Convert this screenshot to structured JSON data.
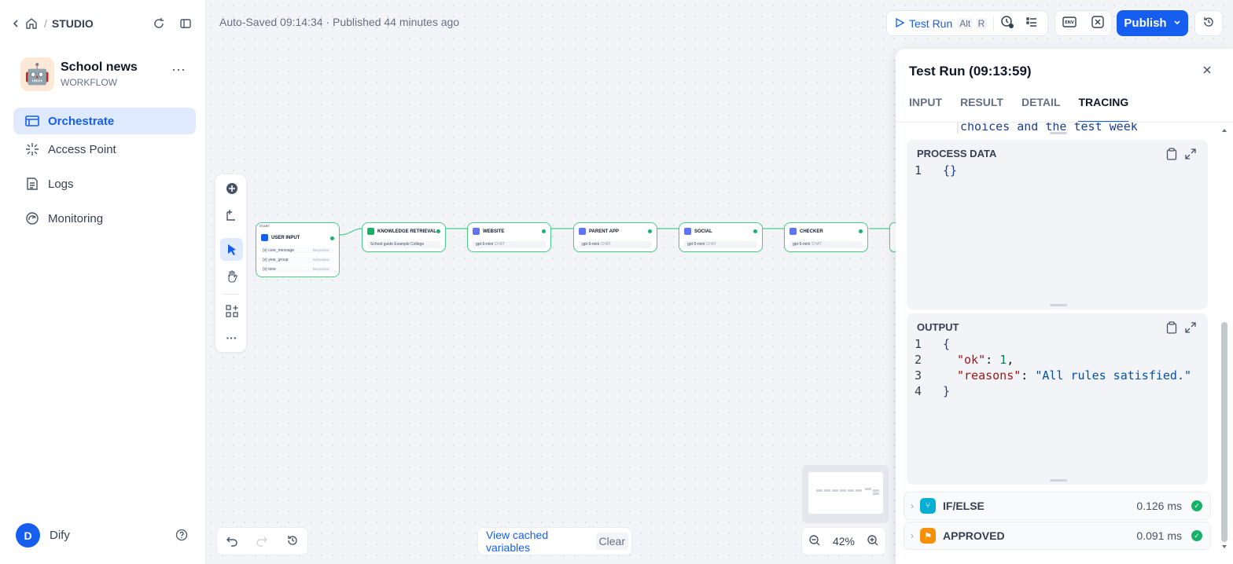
{
  "nav": {
    "studio": "STUDIO",
    "slash": "/"
  },
  "app": {
    "name": "School news",
    "type": "WORKFLOW",
    "avatar": "🤖"
  },
  "menu": [
    {
      "label": "Orchestrate",
      "icon": "orchestrate-icon",
      "active": true
    },
    {
      "label": "Access Point",
      "icon": "access-point-icon",
      "active": false
    },
    {
      "label": "Logs",
      "icon": "logs-icon",
      "active": false
    },
    {
      "label": "Monitoring",
      "icon": "monitoring-icon",
      "active": false
    }
  ],
  "user": {
    "initial": "D",
    "name": "Dify"
  },
  "header": {
    "status": "Auto-Saved 09:14:34 · Published 44 minutes ago",
    "test_run": "Test Run",
    "shortcut_alt": "Alt",
    "shortcut_key": "R",
    "publish": "Publish",
    "env_label": "ENV"
  },
  "canvas": {
    "start_label": "START",
    "user_input": {
      "title": "USER INPUT",
      "vars": [
        "core_message",
        "year_group",
        "tone"
      ],
      "var_prefix": "{x}",
      "required": "REQUIRED"
    },
    "nodes": [
      {
        "title": "KNOWLEDGE RETRIEVAL",
        "sub": "School guide Example College",
        "color": "#17b26a"
      },
      {
        "title": "WEBSITE",
        "sub": "gpt-5-mini",
        "color": "#6172f3"
      },
      {
        "title": "PARENT APP",
        "sub": "gpt-5-mini",
        "color": "#6172f3"
      },
      {
        "title": "SOCIAL",
        "sub": "gpt-5-mini",
        "color": "#6172f3"
      },
      {
        "title": "CHECKER",
        "sub": "gpt-5-mini",
        "color": "#6172f3"
      }
    ],
    "model_badge": "CHAT"
  },
  "bottom": {
    "view_cached": "View cached variables",
    "clear": "Clear",
    "zoom": "42%"
  },
  "panel": {
    "title": "Test Run (09:13:59)",
    "tabs": [
      {
        "label": "INPUT",
        "active": false
      },
      {
        "label": "RESULT",
        "active": false
      },
      {
        "label": "DETAIL",
        "active": false
      },
      {
        "label": "TRACING",
        "active": true
      }
    ],
    "cut_text": "choices and the test week",
    "process_data": {
      "title": "PROCESS DATA",
      "lines": [
        "1"
      ],
      "code": "{}"
    },
    "output": {
      "title": "OUTPUT",
      "lines": [
        "1",
        "2",
        "3",
        "4"
      ],
      "open": "{",
      "key1": "\"ok\"",
      "val1": "1",
      "key2": "\"reasons\"",
      "val2": "\"All rules satisfied.\"",
      "close": "}"
    },
    "trace": [
      {
        "name": "IF/ELSE",
        "time": "0.126 ms",
        "color": "#06aed4"
      },
      {
        "name": "APPROVED",
        "time": "0.091 ms",
        "color": "#f79009"
      }
    ]
  }
}
